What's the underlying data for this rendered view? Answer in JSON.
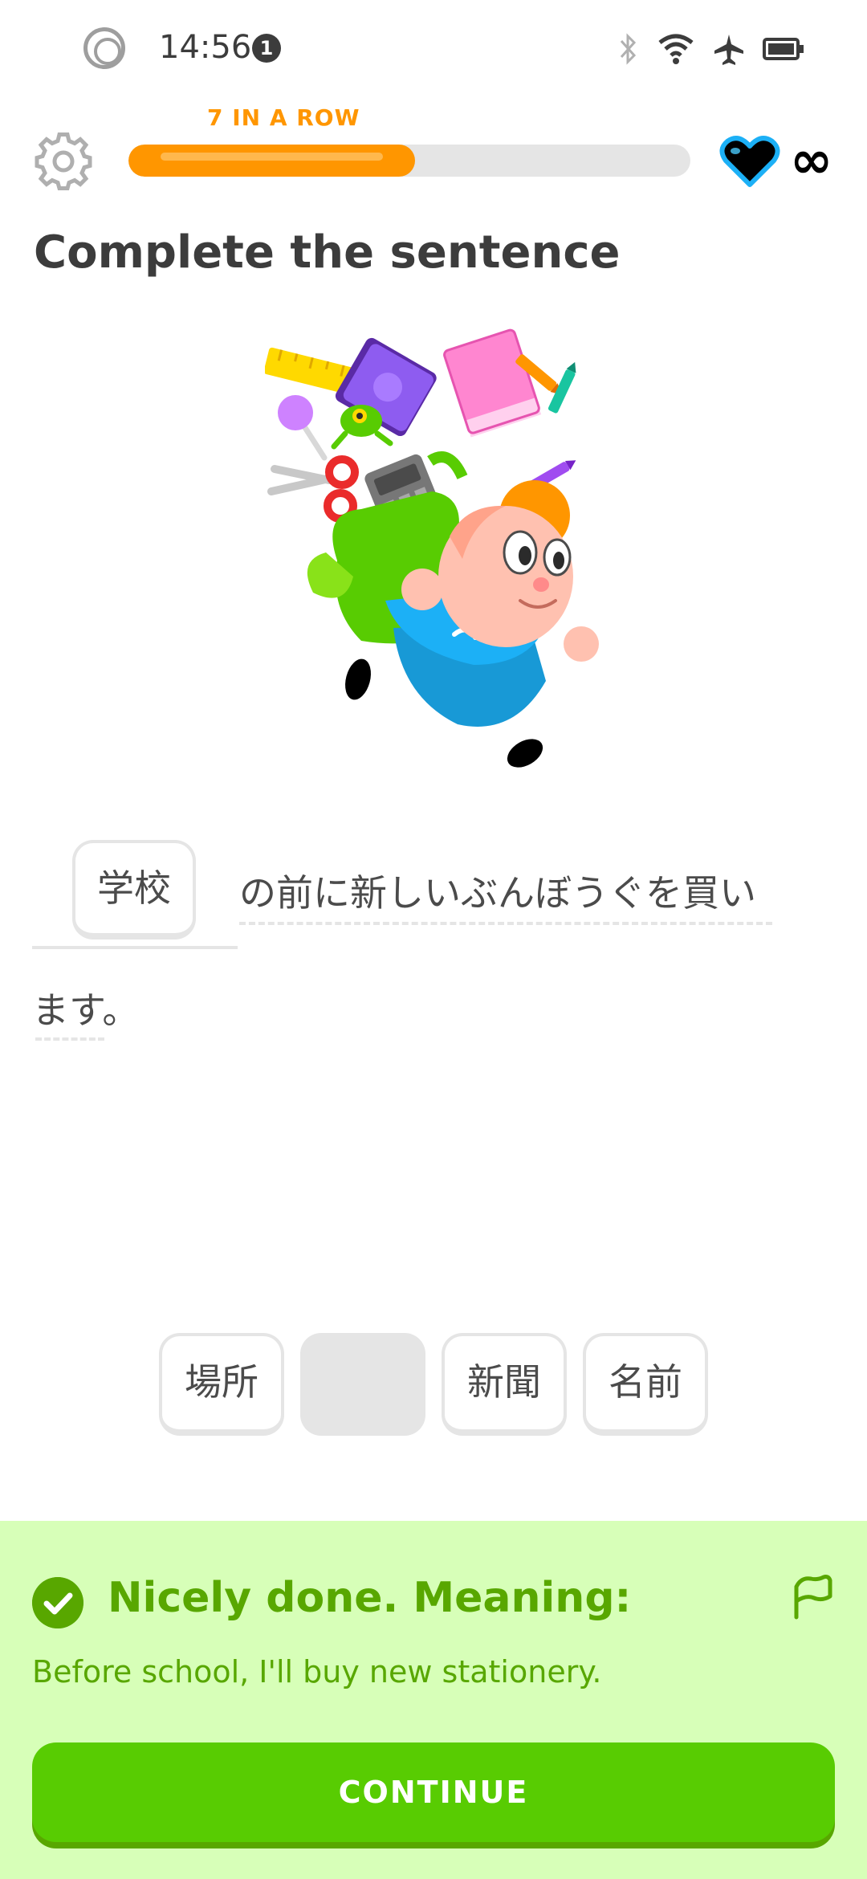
{
  "status_bar": {
    "time": "14:56",
    "notification_count": "1",
    "icons": [
      "bluetooth-icon",
      "wifi-icon",
      "airplane-icon",
      "battery-icon"
    ]
  },
  "header": {
    "streak_label": "7 IN A ROW",
    "progress_fraction": 0.51,
    "hearts_label": "∞"
  },
  "exercise": {
    "title": "Complete the sentence",
    "selected_answer": "学校",
    "sentence_part1": "の前に新しいぶんぼうぐを買い",
    "sentence_part2": "ます。"
  },
  "word_bank": [
    {
      "label": "場所",
      "used": false
    },
    {
      "label": "",
      "used": true
    },
    {
      "label": "新聞",
      "used": false
    },
    {
      "label": "名前",
      "used": false
    }
  ],
  "feedback": {
    "title": "Nicely done. Meaning:",
    "meaning": "Before school, I'll buy new stationery.",
    "continue_label": "CONTINUE"
  },
  "colors": {
    "accent_orange": "#ff9600",
    "success_green": "#58a700",
    "button_green": "#58cc02",
    "feedback_bg": "#d7ffb8"
  }
}
